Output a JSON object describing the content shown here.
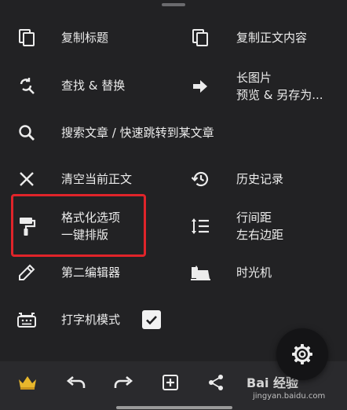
{
  "menu": {
    "copy_title": "复制标题",
    "copy_body": "复制正文内容",
    "find_replace": "查找 & 替换",
    "long_image_1": "长图片",
    "long_image_2": "预览 & 另存为...",
    "search_article": "搜索文章 / 快速跳转到某文章",
    "clear_body": "清空当前正文",
    "history": "历史记录",
    "format_1": "格式化选项",
    "format_2": "一键排版",
    "spacing_1": "行间距",
    "spacing_2": "左右边距",
    "second_editor": "第二编辑器",
    "time_machine": "时光机",
    "typewriter_mode": "打字机模式",
    "typewriter_checked": true
  },
  "watermark": {
    "brand": "Bai 经验",
    "url": "jingyan.baidu.com"
  },
  "colors": {
    "background": "#1f1f21",
    "highlight": "#e0242a",
    "text": "#ececec"
  }
}
